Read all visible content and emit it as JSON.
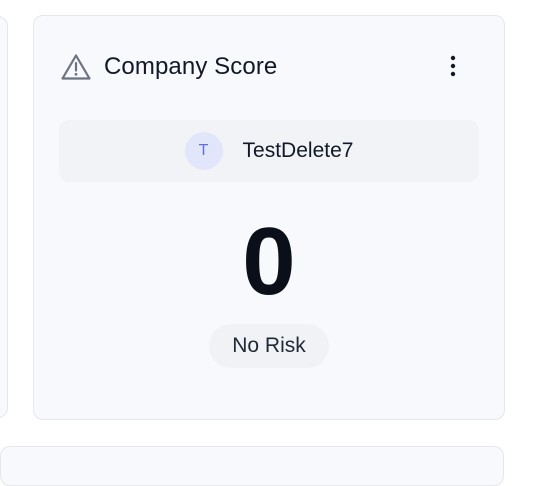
{
  "card": {
    "title": "Company Score",
    "header_icon": "warning-triangle-icon",
    "menu_icon": "more-vertical-icon"
  },
  "company": {
    "avatar_initial": "T",
    "name": "TestDelete7"
  },
  "score": {
    "value": "0",
    "risk_label": "No Risk"
  },
  "colors": {
    "card_background": "#f8f9fc",
    "card_border": "#e5e7eb",
    "avatar_background": "#e2e6fb",
    "avatar_text": "#6170e0",
    "icon_gray": "#6b7280"
  }
}
